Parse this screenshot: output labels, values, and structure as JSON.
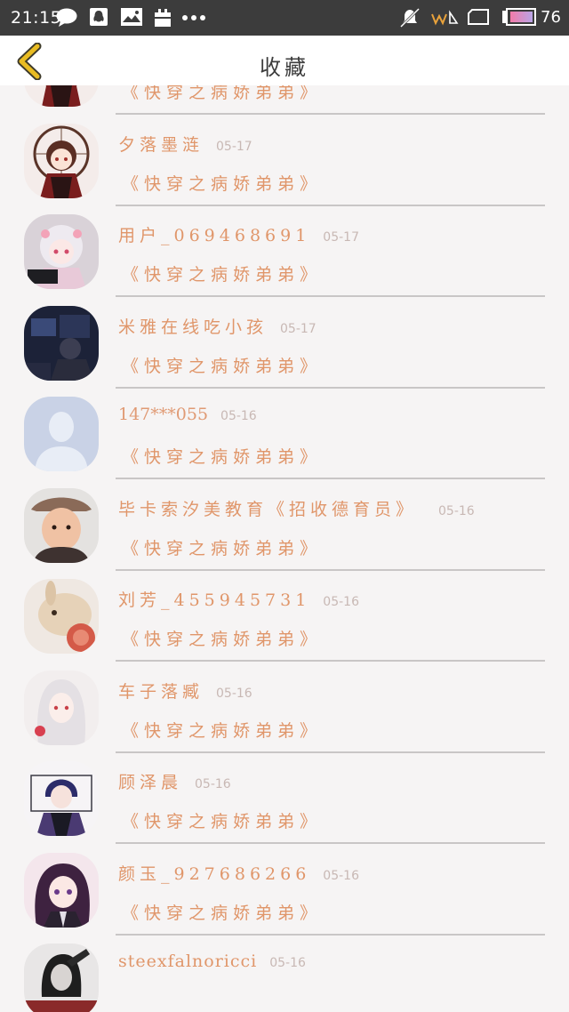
{
  "status_bar": {
    "time": "21:15",
    "battery": "76"
  },
  "header": {
    "title": "收藏"
  },
  "colors": {
    "accent": "#e0966a",
    "back_arrow": "#e9bc22",
    "status_bar_bg": "#3c3c3c",
    "page_bg": "#f6f4f4"
  },
  "favorites": [
    {
      "name": "",
      "date": "",
      "work": "《快穿之病娇弟弟》",
      "avatar": "anime-girl-red-avatar"
    },
    {
      "name": "夕落墨涟",
      "date": "05-17",
      "work": "《快穿之病娇弟弟》",
      "avatar": "anime-girl-red-avatar"
    },
    {
      "name": "用户_069468691",
      "date": "05-17",
      "work": "《快穿之病娇弟弟》",
      "avatar": "anime-girl-white-hair-avatar"
    },
    {
      "name": "米雅在线吃小孩",
      "date": "05-17",
      "work": "《快穿之病娇弟弟》",
      "avatar": "dark-room-photo-avatar"
    },
    {
      "name": "147***055",
      "date": "05-16",
      "work": "《快穿之病娇弟弟》",
      "avatar": "default-person-avatar"
    },
    {
      "name": "毕卡索汐美教育《招收德育员》",
      "date": "05-16",
      "work": "《快穿之病娇弟弟》",
      "avatar": "child-photo-avatar"
    },
    {
      "name": "刘芳_455945731",
      "date": "05-16",
      "work": "《快穿之病娇弟弟》",
      "avatar": "rabbit-photo-avatar"
    },
    {
      "name": "车子落臧",
      "date": "05-16",
      "work": "《快穿之病娇弟弟》",
      "avatar": "anime-white-hair-avatar"
    },
    {
      "name": "顾泽晨",
      "date": "05-16",
      "work": "《快穿之病娇弟弟》",
      "avatar": "anime-boy-purple-avatar"
    },
    {
      "name": "颜玉_927686266",
      "date": "05-16",
      "work": "《快穿之病娇弟弟》",
      "avatar": "anime-girl-purple-avatar"
    },
    {
      "name": "steexfalnoricci",
      "date": "05-16",
      "work": "",
      "avatar": "bw-photo-avatar"
    }
  ]
}
